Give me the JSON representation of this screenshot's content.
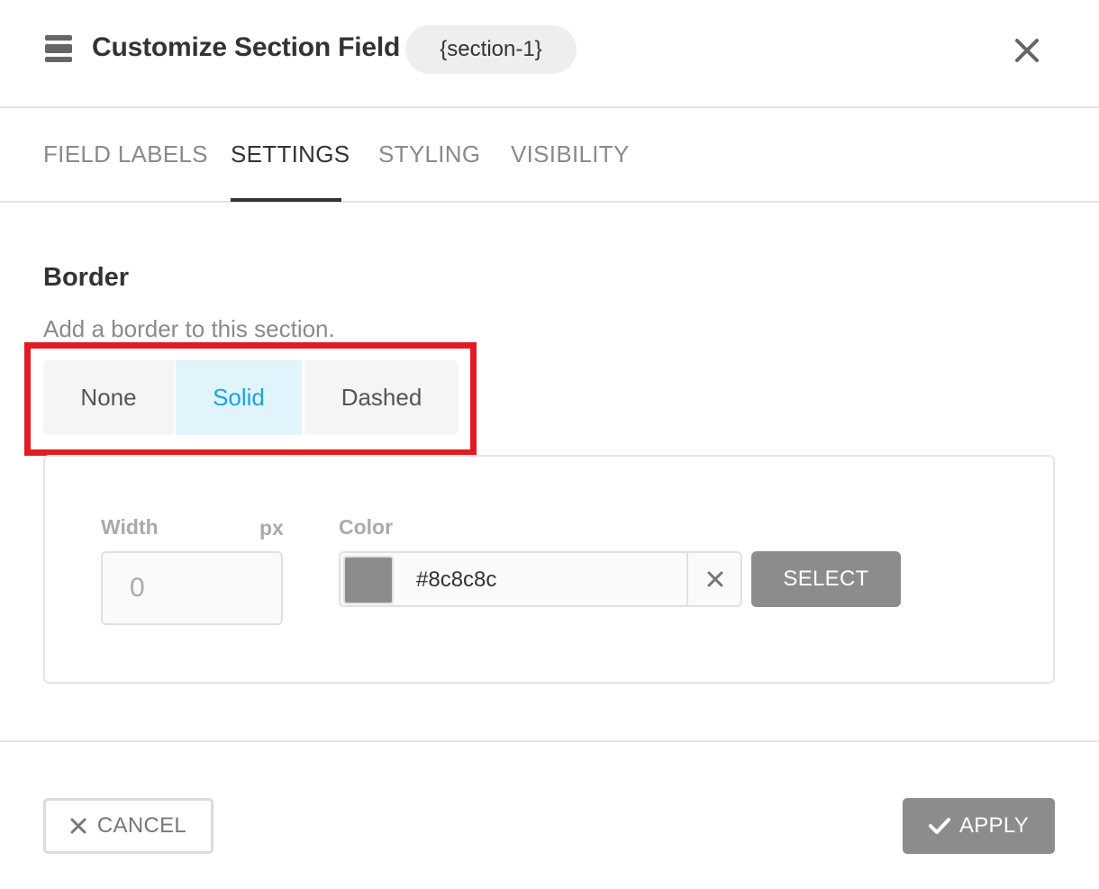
{
  "header": {
    "title": "Customize Section Field",
    "tag": "{section-1}",
    "icon": "section-icon",
    "close_icon": "close-icon"
  },
  "tabs": [
    {
      "label": "FIELD LABELS",
      "active": false
    },
    {
      "label": "SETTINGS",
      "active": true
    },
    {
      "label": "STYLING",
      "active": false
    },
    {
      "label": "VISIBILITY",
      "active": false
    }
  ],
  "border": {
    "title": "Border",
    "description": "Add a border to this section.",
    "options": [
      {
        "label": "None",
        "selected": false
      },
      {
        "label": "Solid",
        "selected": true
      },
      {
        "label": "Dashed",
        "selected": false
      }
    ],
    "width_label": "Width",
    "width_unit": "px",
    "width_placeholder": "0",
    "color_label": "Color",
    "color_value": "#8c8c8c",
    "select_label": "SELECT"
  },
  "footer": {
    "cancel_label": "CANCEL",
    "apply_label": "APPLY"
  },
  "colors": {
    "accent": "#1aa3e0",
    "highlight": "#e11b22",
    "button_gray": "#8c8c8c"
  }
}
